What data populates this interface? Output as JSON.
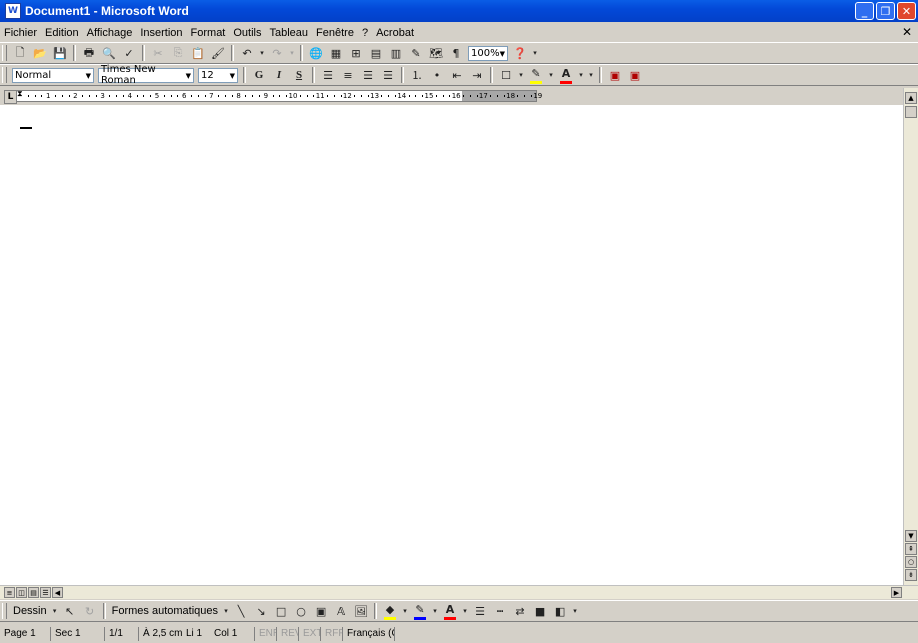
{
  "window": {
    "title": "Document1 - Microsoft Word",
    "app_icon": "W",
    "controls": {
      "minimize": "_",
      "restore": "❐",
      "close": "✕"
    }
  },
  "menubar": {
    "items": [
      "Fichier",
      "Edition",
      "Affichage",
      "Insertion",
      "Format",
      "Outils",
      "Tableau",
      "Fenêtre",
      "?",
      "Acrobat"
    ],
    "doc_close": "✕"
  },
  "standard_toolbar": {
    "zoom": "100%"
  },
  "formatting_toolbar": {
    "style": "Normal",
    "font": "Times New Roman",
    "size": "12",
    "bold": "G",
    "italic": "I",
    "underline": "S",
    "font_color_label": "A",
    "colors": {
      "highlight": "#ffff00",
      "font": "#ff0000"
    }
  },
  "ruler": {
    "tab_selector": "L",
    "numbers": [
      "1",
      "2",
      "3",
      "4",
      "5",
      "6",
      "7",
      "8",
      "9",
      "10",
      "11",
      "12",
      "13",
      "14",
      "15",
      "16",
      "17",
      "18",
      "19"
    ]
  },
  "drawing_toolbar": {
    "draw_label": "Dessin",
    "autoshapes_label": "Formes automatiques",
    "font_color_label": "A",
    "colors": {
      "fill": "#ffff00",
      "line": "#0000ff",
      "font": "#ff0000"
    }
  },
  "statusbar": {
    "page": "Page 1",
    "section": "Sec 1",
    "pages": "1/1",
    "position": "À 2,5 cm",
    "line": "Li 1",
    "column": "Col 1",
    "rec": "ENR",
    "rev": "REV",
    "ext": "EXT",
    "ovr": "RFP",
    "language": "Français (C"
  }
}
